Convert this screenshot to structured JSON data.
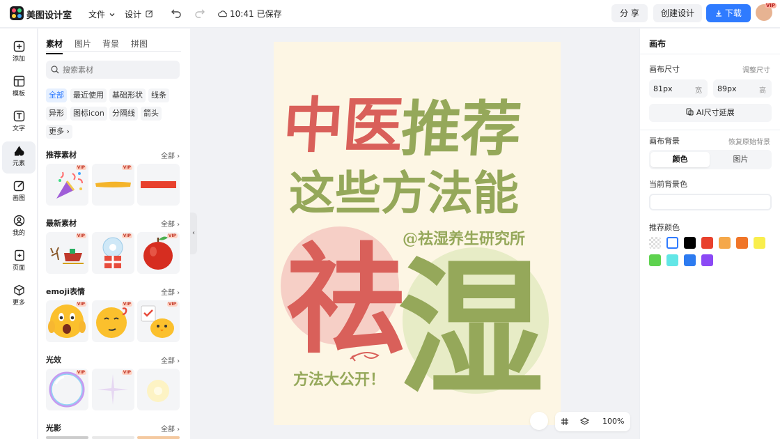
{
  "app": {
    "name": "美图设计室"
  },
  "topbar": {
    "file_menu": "文件",
    "design_menu": "设计",
    "save_time": "10:41",
    "save_status": "已保存",
    "share_label": "分 享",
    "create_label": "创建设计",
    "download_label": "下载",
    "avatar_badge": "VIP"
  },
  "rail": {
    "items": [
      {
        "label": "添加"
      },
      {
        "label": "模板"
      },
      {
        "label": "文字"
      },
      {
        "label": "元素"
      },
      {
        "label": "画图"
      },
      {
        "label": "我的"
      },
      {
        "label": "页面"
      },
      {
        "label": "更多"
      }
    ],
    "active_index": 3
  },
  "panel": {
    "tabs": [
      "素材",
      "图片",
      "背景",
      "拼图"
    ],
    "active_tab": "素材",
    "search_placeholder": "搜索素材",
    "chips": [
      "全部",
      "最近使用",
      "基础形状",
      "线条",
      "异形",
      "图标icon",
      "分隔线",
      "箭头",
      "更多"
    ],
    "active_chip": "全部",
    "all_label": "全部",
    "sections": [
      {
        "title": "推荐素材"
      },
      {
        "title": "最新素材"
      },
      {
        "title": "emoji表情"
      },
      {
        "title": "光效"
      },
      {
        "title": "光影"
      }
    ],
    "vip_label": "VIP"
  },
  "canvas": {
    "line1": "中医推荐",
    "line2": "这些方法能",
    "handle": "@祛湿养生研究所",
    "big_char_1": "祛",
    "big_char_2": "湿",
    "footer": "方法大公开！",
    "colors": {
      "background": "#fdf6e4",
      "red": "#d9605a",
      "green": "#95a85a",
      "pink_circle": "#f6cfc6",
      "green_circle": "#e7ecc6"
    }
  },
  "bottom_tools": {
    "zoom": "100%"
  },
  "right_panel": {
    "title": "画布",
    "size_label": "画布尺寸",
    "resize_link": "调整尺寸",
    "width_value": "81px",
    "width_unit": "宽",
    "height_value": "89px",
    "height_unit": "高",
    "ai_extend_label": "AI尺寸延展",
    "bg_label": "画布背景",
    "restore_label": "恢复原始背景",
    "seg_color": "颜色",
    "seg_image": "图片",
    "current_bg_label": "当前背景色",
    "recommend_label": "推荐颜色",
    "swatches": [
      "transparent",
      "#ffffff",
      "#000000",
      "#e8412d",
      "#f5a84a",
      "#f07528",
      "#f9ee4d",
      "#5ed24f",
      "#62e6e6",
      "#2d7bf0",
      "#8b49f5"
    ]
  }
}
